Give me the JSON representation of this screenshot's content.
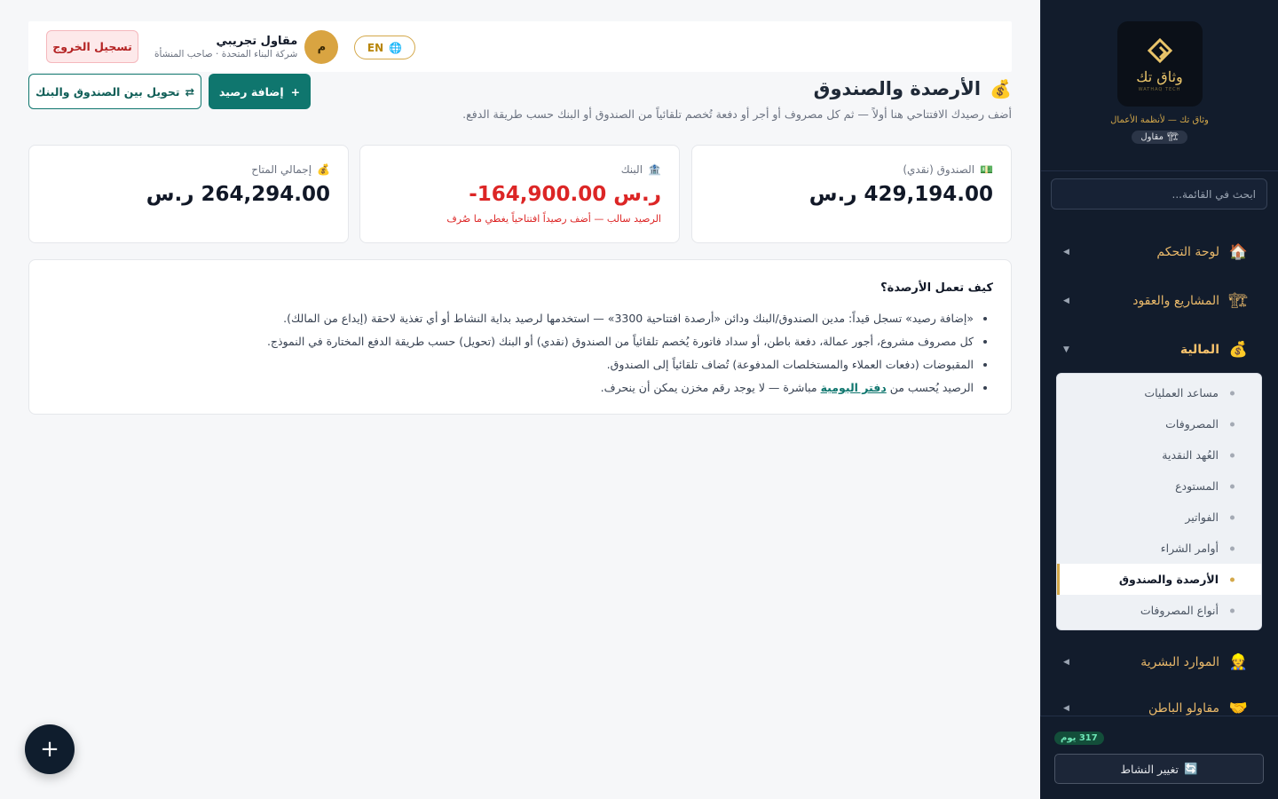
{
  "sidebar": {
    "logo_text": "وثاق تك",
    "logo_sub": "WATHAQ TECH",
    "tagline": "وثاق تك — لأنظمة الأعمال",
    "role_badge": "مقاول",
    "role_icon": "🏗",
    "search_placeholder": "ابحث في القائمة...",
    "nav": [
      {
        "label": "لوحة التحكم",
        "icon": "🏠"
      },
      {
        "label": "المشاريع والعقود",
        "icon": "🏗"
      },
      {
        "label": "المالية",
        "icon": "💰"
      }
    ],
    "finance_submenu": [
      {
        "label": "مساعد العمليات"
      },
      {
        "label": "المصروفات"
      },
      {
        "label": "العُهد النقدية"
      },
      {
        "label": "المستودع"
      },
      {
        "label": "الفواتير"
      },
      {
        "label": "أوامر الشراء"
      },
      {
        "label": "الأرصدة والصندوق"
      },
      {
        "label": "أنواع المصروفات"
      }
    ],
    "nav_after": [
      {
        "label": "الموارد البشرية",
        "icon": "👷"
      },
      {
        "label": "مقاولو الباطن",
        "icon": "🤝"
      }
    ],
    "days_badge": "317 يوم",
    "switch_button": "تغيير النشاط",
    "switch_icon": "🔄"
  },
  "topbar": {
    "logout": "تسجيل الخروج",
    "user_name": "مقاول تجريبي",
    "user_sub": "شركة البناء المتحدة · صاحب المنشأة",
    "avatar_letter": "م",
    "lang": "EN",
    "lang_icon": "🌐"
  },
  "page": {
    "title": "الأرصدة والصندوق",
    "title_icon": "💰",
    "description": "أضف رصيدك الافتتاحي هنا أولاً — ثم كل مصروف أو أجر أو دفعة تُخصم تلقائياً من الصندوق أو البنك حسب طريقة الدفع.",
    "add_button": "إضافة رصيد",
    "add_icon": "+",
    "transfer_button": "تحويل بين الصندوق والبنك",
    "transfer_icon": "⇄"
  },
  "cards": [
    {
      "label": "الصندوق (نقدي)",
      "icon": "💵",
      "value": "429,194.00 ر.س",
      "note": ""
    },
    {
      "label": "البنك",
      "icon": "🏦",
      "value": "-164,900.00 ر.س",
      "note": "الرصيد سالب — أضف رصيداً افتتاحياً يغطي ما صُرف"
    },
    {
      "label": "إجمالي المتاح",
      "icon": "💰",
      "value": "264,294.00 ر.س",
      "note": ""
    }
  ],
  "info": {
    "title": "كيف تعمل الأرصدة؟",
    "items": [
      "«إضافة رصيد» تسجل قيداً: مدين الصندوق/البنك ودائن «أرصدة افتتاحية 3300» — استخدمها لرصيد بداية النشاط أو أي تغذية لاحقة (إيداع من المالك).",
      "كل مصروف مشروع، أجور عمالة، دفعة باطن، أو سداد فاتورة يُخصم تلقائياً من الصندوق (نقدي) أو البنك (تحويل) حسب طريقة الدفع المختارة في النموذج.",
      "المقبوضات (دفعات العملاء والمستخلصات المدفوعة) تُضاف تلقائياً إلى الصندوق."
    ],
    "last_prefix": "الرصيد يُحسب من",
    "last_link": "دفتر اليومية",
    "last_suffix": "مباشرة — لا يوجد رقم مخزن يمكن أن ينحرف."
  },
  "fab_label": "+"
}
